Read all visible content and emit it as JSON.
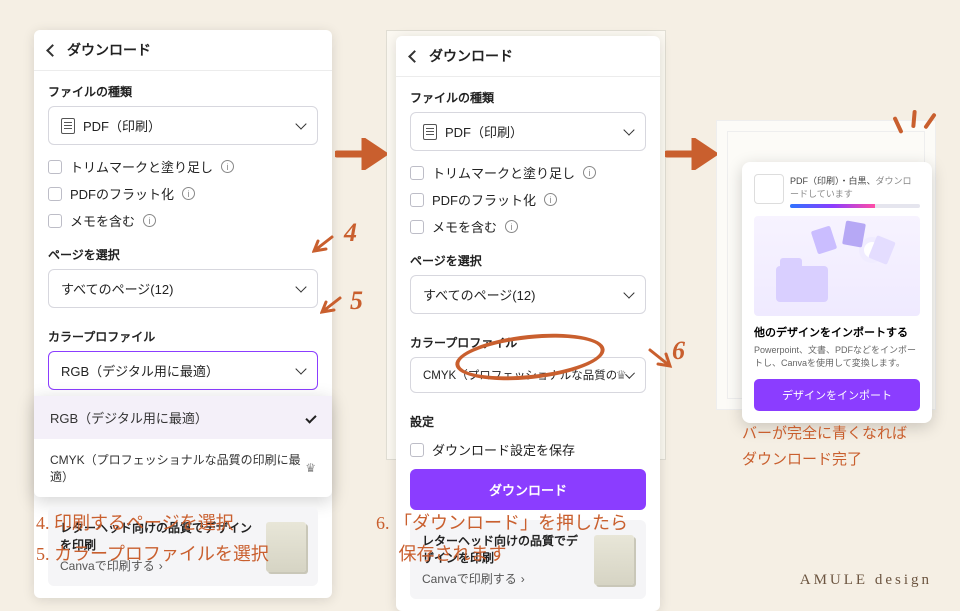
{
  "panel1": {
    "title": "ダウンロード",
    "filetype_label": "ファイルの種類",
    "filetype_value": "PDF（印刷）",
    "opt_trim": "トリムマークと塗り足し",
    "opt_flatten": "PDFのフラット化",
    "opt_memo": "メモを含む",
    "pages_label": "ページを選択",
    "pages_value": "すべてのページ(12)",
    "color_label": "カラープロファイル",
    "color_value": "RGB（デジタル用に最適）",
    "dd_rgb": "RGB（デジタル用に最適）",
    "dd_cmyk": "CMYK（プロフェッショナルな品質の印刷に最適）",
    "promo_title": "レターヘッド向けの品質でデザインを印刷",
    "promo_link": "Canvaで印刷する"
  },
  "panel2": {
    "title": "ダウンロード",
    "filetype_label": "ファイルの種類",
    "filetype_value": "PDF（印刷）",
    "opt_trim": "トリムマークと塗り足し",
    "opt_flatten": "PDFのフラット化",
    "opt_memo": "メモを含む",
    "pages_label": "ページを選択",
    "pages_value": "すべてのページ(12)",
    "color_label": "カラープロファイル",
    "color_value": "CMYK（プロフェッショナルな品質の印刷に最…",
    "settings_label": "設定",
    "opt_save": "ダウンロード設定を保存",
    "dl_button": "ダウンロード",
    "promo_title": "レターヘッド向けの品質でデザインを印刷",
    "promo_link": "Canvaで印刷する"
  },
  "panel3": {
    "file_label": "PDF（印刷）・白黒、",
    "status": "ダウンロードしています",
    "import_title": "他のデザインをインポートする",
    "import_desc": "Powerpoint、文書、PDFなどをインポートし、Canvaを使用して変換します。",
    "import_btn": "デザインをインポート"
  },
  "steps": {
    "s4": "4",
    "s5": "5",
    "s6": "6"
  },
  "captions": {
    "left": "4. 印刷するページを選択\n5. カラープロファイルを選択",
    "mid": "6. 「ダウンロード」を押したら\n　 保存されます",
    "right": "バーが完全に青くなれば\nダウンロード完了"
  },
  "brand": "AMULE design",
  "info_glyph": "i",
  "chev_right": "›"
}
